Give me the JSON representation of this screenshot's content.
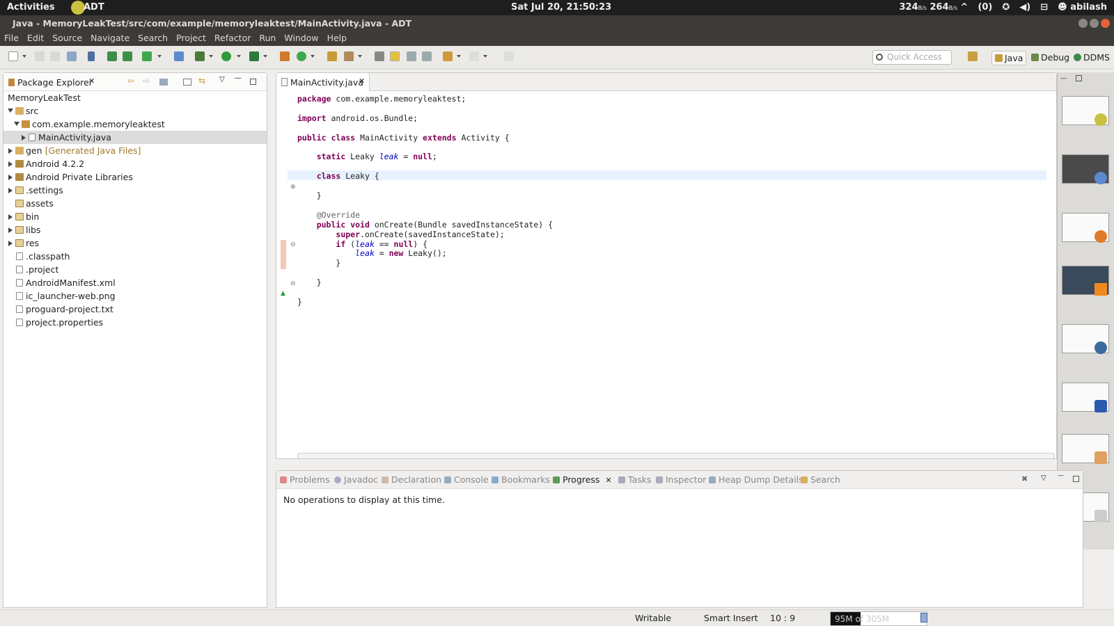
{
  "topbar": {
    "activities": "Activities",
    "app": "ADT",
    "clock": "Sat Jul 20, 21:50:23",
    "net_down": "324",
    "net_down_unit": "B/s",
    "net_up": "264",
    "net_up_unit": "B/s",
    "messages": "(0)",
    "user": "abilash"
  },
  "window": {
    "title": "Java - MemoryLeakTest/src/com/example/memoryleaktest/MainActivity.java - ADT"
  },
  "menu": [
    "File",
    "Edit",
    "Source",
    "Navigate",
    "Search",
    "Project",
    "Refactor",
    "Run",
    "Window",
    "Help"
  ],
  "toolbar": {
    "quick_access_placeholder": "Quick Access",
    "perspectives": [
      "Java",
      "Debug",
      "DDMS"
    ]
  },
  "package_explorer": {
    "tab_label": "Package Explorer",
    "project": "MemoryLeakTest",
    "items": [
      {
        "label": "src"
      },
      {
        "label": "com.example.memoryleaktest"
      },
      {
        "label": "MainActivity.java"
      },
      {
        "label": "gen",
        "extra": "[Generated Java Files]"
      },
      {
        "label": "Android 4.2.2"
      },
      {
        "label": "Android Private Libraries"
      },
      {
        "label": ".settings"
      },
      {
        "label": "assets"
      },
      {
        "label": "bin"
      },
      {
        "label": "libs"
      },
      {
        "label": "res"
      },
      {
        "label": ".classpath"
      },
      {
        "label": ".project"
      },
      {
        "label": "AndroidManifest.xml"
      },
      {
        "label": "ic_launcher-web.png"
      },
      {
        "label": "proguard-project.txt"
      },
      {
        "label": "project.properties"
      }
    ]
  },
  "editor": {
    "tab": "MainActivity.java",
    "lines": [
      [
        {
          "t": "package",
          "c": "kw"
        },
        {
          "t": " com.example.memoryleaktest;"
        }
      ],
      [
        {
          "t": "import",
          "c": "kw"
        },
        {
          "t": " android.os.Bundle;"
        }
      ],
      [
        {
          "t": "public",
          "c": "kw"
        },
        {
          "t": " "
        },
        {
          "t": "class",
          "c": "kw"
        },
        {
          "t": " MainActivity "
        },
        {
          "t": "extends",
          "c": "kw"
        },
        {
          "t": " Activity {"
        }
      ],
      [
        {
          "t": "    "
        },
        {
          "t": "static",
          "c": "kw"
        },
        {
          "t": " Leaky "
        },
        {
          "t": "leak",
          "c": "fld"
        },
        {
          "t": " = "
        },
        {
          "t": "null",
          "c": "kw"
        },
        {
          "t": ";"
        }
      ],
      [
        {
          "t": "    "
        },
        {
          "t": "class",
          "c": "kw"
        },
        {
          "t": " Leaky {"
        }
      ],
      [
        {
          "t": "    }"
        }
      ],
      [
        {
          "t": "    "
        },
        {
          "t": "@Override",
          "c": "ann"
        }
      ],
      [
        {
          "t": "    "
        },
        {
          "t": "public",
          "c": "kw"
        },
        {
          "t": " "
        },
        {
          "t": "void",
          "c": "kw"
        },
        {
          "t": " onCreate(Bundle savedInstanceState) {"
        }
      ],
      [
        {
          "t": "        "
        },
        {
          "t": "super",
          "c": "kw"
        },
        {
          "t": ".onCreate(savedInstanceState);"
        }
      ],
      [
        {
          "t": "        "
        },
        {
          "t": "if",
          "c": "kw"
        },
        {
          "t": " ("
        },
        {
          "t": "leak",
          "c": "fld"
        },
        {
          "t": " == "
        },
        {
          "t": "null",
          "c": "kw"
        },
        {
          "t": ") {"
        }
      ],
      [
        {
          "t": "            "
        },
        {
          "t": "leak",
          "c": "fld"
        },
        {
          "t": " = "
        },
        {
          "t": "new",
          "c": "kw"
        },
        {
          "t": " Leaky();"
        }
      ],
      [
        {
          "t": "        }"
        }
      ],
      [
        {
          "t": "    }"
        }
      ],
      [
        {
          "t": "}"
        }
      ]
    ]
  },
  "bottom_panel": {
    "tabs": [
      "Problems",
      "Javadoc",
      "Declaration",
      "Console",
      "Bookmarks",
      "Progress",
      "Tasks",
      "Inspector",
      "Heap Dump Details",
      "Search"
    ],
    "active_tab": "Progress",
    "message": "No operations to display at this time."
  },
  "status": {
    "writable": "Writable",
    "insert_mode": "Smart Insert",
    "position": "10 : 9",
    "heap": "95M of 305M",
    "heap_used_fraction": 0.31
  }
}
